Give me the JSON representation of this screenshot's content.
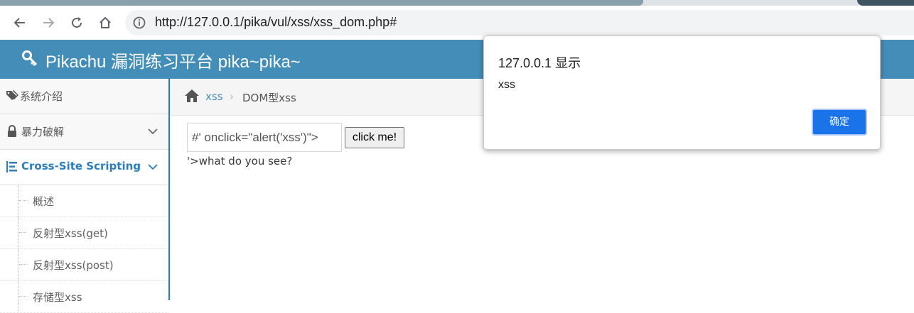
{
  "browser": {
    "url": "http://127.0.0.1/pika/vul/xss/xss_dom.php#",
    "icons": [
      "back-arrow-icon",
      "forward-arrow-icon",
      "reload-icon",
      "home-icon",
      "info-icon"
    ]
  },
  "header": {
    "title": "Pikachu 漏洞练习平台 pika~pika~",
    "brand_color": "#438eb9"
  },
  "sidebar": {
    "items": [
      {
        "label": "系统介绍",
        "icon": "tags-icon"
      },
      {
        "label": "暴力破解",
        "icon": "lock-icon"
      },
      {
        "label": "Cross-Site Scripting",
        "icon": "list-icon",
        "active": true
      }
    ],
    "sub_items": [
      {
        "label": "概述"
      },
      {
        "label": "反射型xss(get)"
      },
      {
        "label": "反射型xss(post)"
      },
      {
        "label": "存储型xss"
      }
    ]
  },
  "breadcrumb": {
    "crumb1": "xss",
    "separator": "›",
    "crumb2": "DOM型xss"
  },
  "content": {
    "input_value": "#' onclick=\"alert('xss')\">",
    "button_label": "click me!",
    "result_text": "'>what do you see?"
  },
  "dialog": {
    "title": "127.0.0.1 显示",
    "message": "xss",
    "ok_label": "确定",
    "ok_color": "#1a73e8"
  }
}
